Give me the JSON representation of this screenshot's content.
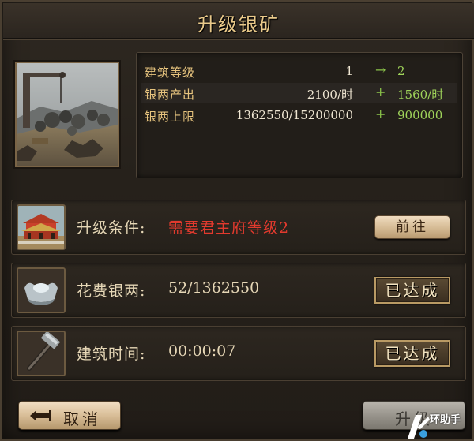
{
  "dialog": {
    "title": "升级银矿"
  },
  "building": {
    "image_icon": "silver-mine-picture"
  },
  "stats": [
    {
      "label": "建筑等级",
      "current": "1",
      "op": "→",
      "next": "2"
    },
    {
      "label": "银两产出",
      "current": "2100/时",
      "op": "+",
      "next": "1560/时"
    },
    {
      "label": "银两上限",
      "current": "1362550/15200000",
      "op": "+",
      "next": "900000"
    }
  ],
  "requirements": {
    "condition": {
      "label": "升级条件:",
      "value": "需要君主府等级2",
      "button": "前往",
      "icon": "palace-icon"
    },
    "silver": {
      "label": "花费银两:",
      "value": "52/1362550",
      "status": "已达成",
      "icon": "silver-ingot-icon"
    },
    "time": {
      "label": "建筑时间:",
      "value": "00:00:07",
      "status": "已达成",
      "icon": "hammer-icon"
    }
  },
  "buttons": {
    "cancel": "取消",
    "upgrade": "升级"
  },
  "watermark": {
    "text": "环助手"
  },
  "colors": {
    "title": "#e9c98a",
    "stat_label": "#e7c47e",
    "increase": "#9fd35a",
    "requirement_unmet": "#e23a2e"
  }
}
